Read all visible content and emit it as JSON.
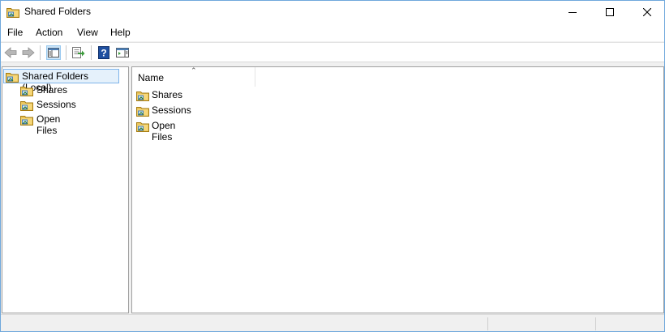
{
  "window": {
    "title": "Shared Folders"
  },
  "menu": {
    "items": [
      "File",
      "Action",
      "View",
      "Help"
    ]
  },
  "tree": {
    "root": "Shared Folders (Local)",
    "children": [
      "Shares",
      "Sessions",
      "Open Files"
    ]
  },
  "list": {
    "column_header": "Name",
    "items": [
      "Shares",
      "Sessions",
      "Open Files"
    ]
  },
  "colors": {
    "selection_bg": "#e5f1fb",
    "selection_border": "#7eb4ea",
    "folder_yellow": "#e8c35a",
    "toolbar_green": "#3c9a3c",
    "help_blue": "#1e4fa0"
  },
  "icons": {
    "title": "shared-folder-icon",
    "back": "arrow-left-icon",
    "forward": "arrow-right-icon",
    "show_hide_tree": "console-tree-icon",
    "export": "export-list-icon",
    "help": "help-icon",
    "action_pane": "action-pane-icon"
  }
}
